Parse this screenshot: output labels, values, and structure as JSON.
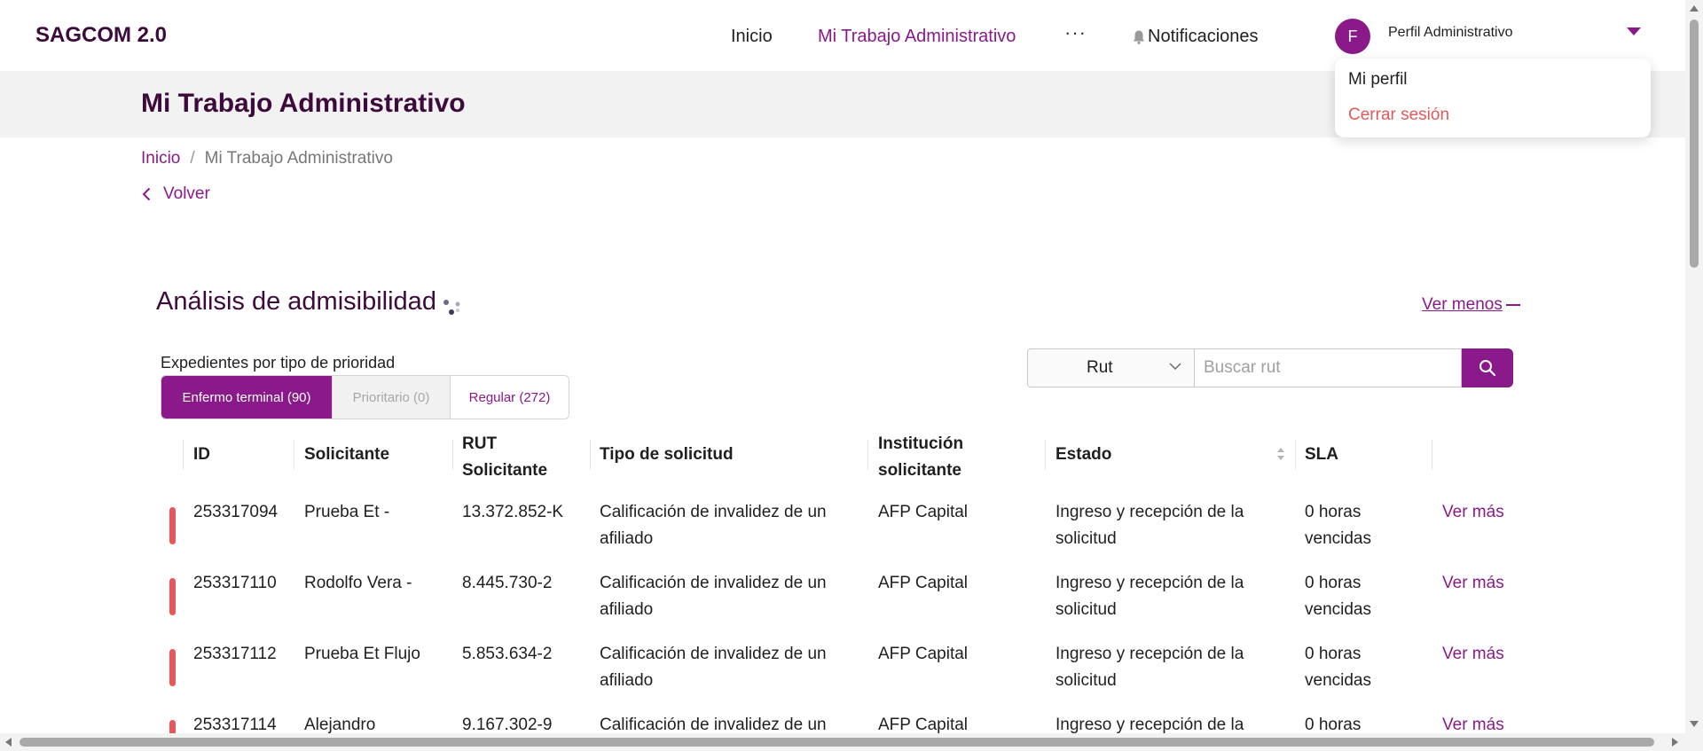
{
  "app": {
    "brand": "SAGCOM 2.0"
  },
  "nav": {
    "links": [
      "Inicio",
      "Mi Trabajo Administrativo"
    ],
    "more": "···",
    "notifications": "Notificaciones",
    "profile_initial": "F",
    "profile_name": "Perfil Administrativo"
  },
  "dropdown": {
    "items": [
      "Mi perfil",
      "Cerrar sesión"
    ]
  },
  "page": {
    "title": "Mi Trabajo Administrativo"
  },
  "breadcrumb": {
    "home": "Inicio",
    "separator": "/",
    "current": "Mi Trabajo Administrativo"
  },
  "back_label": "Volver",
  "section": {
    "title": "Análisis de admisibilidad",
    "toggle_label": "Ver menos",
    "filter_caption": "Expedientes por tipo de prioridad",
    "tabs": [
      "Enfermo terminal (90)",
      "Prioritario (0)",
      "Regular (272)"
    ],
    "search": {
      "type_value": "Rut",
      "placeholder": "Buscar rut"
    }
  },
  "table": {
    "headers": {
      "id": "ID",
      "solicitante": "Solicitante",
      "rut_line1": "RUT",
      "rut_line2": "Solicitante",
      "tipo": "Tipo de solicitud",
      "inst_line1": "Institución",
      "inst_line2": "solicitante",
      "estado": "Estado",
      "sla": "SLA"
    },
    "rows": [
      {
        "id": "253317094",
        "solicitante": "Prueba Et -",
        "rut": "13.372.852-K",
        "tipo_1": "Calificación de invalidez de un",
        "tipo_2": "afiliado",
        "institucion": "AFP Capital",
        "estado_1": "Ingreso y recepción de la",
        "estado_2": "solicitud",
        "sla_1": "0 horas",
        "sla_2": "vencidas",
        "action": "Ver más"
      },
      {
        "id": "253317110",
        "solicitante": "Rodolfo Vera -",
        "rut": "8.445.730-2",
        "tipo_1": "Calificación de invalidez de un",
        "tipo_2": "afiliado",
        "institucion": "AFP Capital",
        "estado_1": "Ingreso y recepción de la",
        "estado_2": "solicitud",
        "sla_1": "0 horas",
        "sla_2": "vencidas",
        "action": "Ver más"
      },
      {
        "id": "253317112",
        "solicitante": "Prueba Et Flujo",
        "rut": "5.853.634-2",
        "tipo_1": "Calificación de invalidez de un",
        "tipo_2": "afiliado",
        "institucion": "AFP Capital",
        "estado_1": "Ingreso y recepción de la",
        "estado_2": "solicitud",
        "sla_1": "0 horas",
        "sla_2": "vencidas",
        "action": "Ver más"
      },
      {
        "id": "253317114",
        "solicitante": "Alejandro",
        "rut": "9.167.302-9",
        "tipo_1": "Calificación de invalidez de un",
        "tipo_2": "",
        "institucion": "AFP Capital",
        "estado_1": "Ingreso y recepción de la",
        "estado_2": "",
        "sla_1": "0 horas",
        "sla_2": "",
        "action": "Ver más"
      }
    ]
  },
  "colors": {
    "brand": "#3d0a3c",
    "accent": "#8a1a8a",
    "danger": "#e05a5a",
    "priority_bar": "#e8575a",
    "header_band": "#f2f2f2"
  },
  "icons": [
    "bell-icon",
    "chevron-down-icon",
    "chevron-left-icon",
    "loading-spinner-icon",
    "search-icon",
    "sort-icon",
    "minus-icon"
  ]
}
